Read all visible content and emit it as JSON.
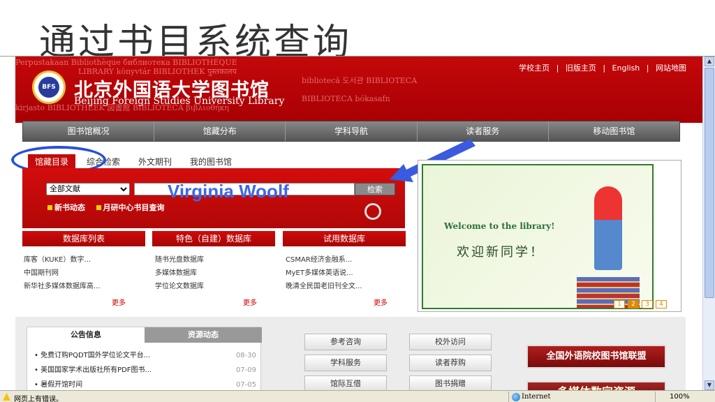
{
  "slide_title": "通过书目系统查询",
  "header": {
    "background_words": [
      "Perpustakaan  Bibliothèque  библиотека  BIBLIOTHÈQUE",
      "LIBRARY  könyvtár  BIBLIOTHEK  पुस्तकालय",
      "bibliotecă  도서관  BIBLIOTECA",
      "BIBLIOTECA  bókasafn",
      "kirjasto  BIBLIOTHEEK  図書館  BIBLIOTECA  βιβλιοθήκη"
    ],
    "logo_text": "BFS",
    "name_cn": "北京外国语大学图书馆",
    "name_en": "Beijing Foreign Studies University Library",
    "top_links": [
      "学校主页",
      "|",
      "旧版主页",
      "|",
      "English",
      "|",
      "网站地图"
    ]
  },
  "nav": [
    "图书馆概况",
    "馆藏分布",
    "学科导航",
    "读者服务",
    "移动图书馆"
  ],
  "search": {
    "tabs": [
      "馆藏目录",
      "综合检索",
      "外文期刊",
      "我的图书馆"
    ],
    "active_tab": 0,
    "scope": "全部文献",
    "query_annotation": "Virginia Woolf",
    "button": "检索",
    "links": [
      "新书动态",
      "月研中心书目查询"
    ]
  },
  "databases": [
    {
      "title": "数据库列表",
      "items": [
        "库客（KUKE）数字...",
        "中国期刊网",
        "新华社多媒体数据库高..."
      ],
      "more": "更多"
    },
    {
      "title": "特色（自建）数据库",
      "items": [
        "随书光盘数据库",
        "多媒体数据库",
        "学位论文数据库"
      ],
      "more": "更多"
    },
    {
      "title": "试用数据库",
      "items": [
        "CSMAR经济金融系...",
        "MyET多媒体英语说...",
        "晚清全民国老旧刊全文..."
      ],
      "more": "更多"
    }
  ],
  "banner": {
    "welcome_en": "Welcome to the library!",
    "welcome_cn": "欢迎新同学！",
    "pages": [
      "1",
      "2",
      "3",
      "4"
    ],
    "current_page": 2
  },
  "notices": {
    "tabs": [
      "公告信息",
      "资源动态"
    ],
    "items": [
      {
        "text": "免费订购PQDT国外学位论文平台...",
        "date": "08-30"
      },
      {
        "text": "美国国家学术出版社所有PDF图书...",
        "date": "07-09"
      },
      {
        "text": "暑假开馆时间",
        "date": "07-05"
      }
    ]
  },
  "services": [
    "参考咨询",
    "校外访问",
    "学科服务",
    "读者荐购",
    "馆际互借",
    "图书捐赠"
  ],
  "alliance": "全国外语院校图书馆联盟",
  "multimedia": "多媒体数字资源",
  "status": {
    "text": "网页上有错误。",
    "zone": "Internet",
    "zoom": "100%"
  },
  "colors": {
    "primary_red": "#c4080a",
    "annotation_blue": "#2a4fd8"
  }
}
